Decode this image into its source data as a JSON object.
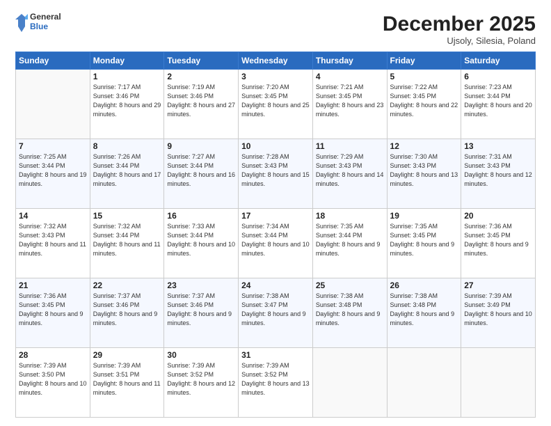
{
  "logo": {
    "general": "General",
    "blue": "Blue"
  },
  "header": {
    "title": "December 2025",
    "subtitle": "Ujsoly, Silesia, Poland"
  },
  "days_of_week": [
    "Sunday",
    "Monday",
    "Tuesday",
    "Wednesday",
    "Thursday",
    "Friday",
    "Saturday"
  ],
  "weeks": [
    [
      {
        "num": "",
        "sunrise": "",
        "sunset": "",
        "daylight": ""
      },
      {
        "num": "1",
        "sunrise": "Sunrise: 7:17 AM",
        "sunset": "Sunset: 3:46 PM",
        "daylight": "Daylight: 8 hours and 29 minutes."
      },
      {
        "num": "2",
        "sunrise": "Sunrise: 7:19 AM",
        "sunset": "Sunset: 3:46 PM",
        "daylight": "Daylight: 8 hours and 27 minutes."
      },
      {
        "num": "3",
        "sunrise": "Sunrise: 7:20 AM",
        "sunset": "Sunset: 3:45 PM",
        "daylight": "Daylight: 8 hours and 25 minutes."
      },
      {
        "num": "4",
        "sunrise": "Sunrise: 7:21 AM",
        "sunset": "Sunset: 3:45 PM",
        "daylight": "Daylight: 8 hours and 23 minutes."
      },
      {
        "num": "5",
        "sunrise": "Sunrise: 7:22 AM",
        "sunset": "Sunset: 3:45 PM",
        "daylight": "Daylight: 8 hours and 22 minutes."
      },
      {
        "num": "6",
        "sunrise": "Sunrise: 7:23 AM",
        "sunset": "Sunset: 3:44 PM",
        "daylight": "Daylight: 8 hours and 20 minutes."
      }
    ],
    [
      {
        "num": "7",
        "sunrise": "Sunrise: 7:25 AM",
        "sunset": "Sunset: 3:44 PM",
        "daylight": "Daylight: 8 hours and 19 minutes."
      },
      {
        "num": "8",
        "sunrise": "Sunrise: 7:26 AM",
        "sunset": "Sunset: 3:44 PM",
        "daylight": "Daylight: 8 hours and 17 minutes."
      },
      {
        "num": "9",
        "sunrise": "Sunrise: 7:27 AM",
        "sunset": "Sunset: 3:44 PM",
        "daylight": "Daylight: 8 hours and 16 minutes."
      },
      {
        "num": "10",
        "sunrise": "Sunrise: 7:28 AM",
        "sunset": "Sunset: 3:43 PM",
        "daylight": "Daylight: 8 hours and 15 minutes."
      },
      {
        "num": "11",
        "sunrise": "Sunrise: 7:29 AM",
        "sunset": "Sunset: 3:43 PM",
        "daylight": "Daylight: 8 hours and 14 minutes."
      },
      {
        "num": "12",
        "sunrise": "Sunrise: 7:30 AM",
        "sunset": "Sunset: 3:43 PM",
        "daylight": "Daylight: 8 hours and 13 minutes."
      },
      {
        "num": "13",
        "sunrise": "Sunrise: 7:31 AM",
        "sunset": "Sunset: 3:43 PM",
        "daylight": "Daylight: 8 hours and 12 minutes."
      }
    ],
    [
      {
        "num": "14",
        "sunrise": "Sunrise: 7:32 AM",
        "sunset": "Sunset: 3:43 PM",
        "daylight": "Daylight: 8 hours and 11 minutes."
      },
      {
        "num": "15",
        "sunrise": "Sunrise: 7:32 AM",
        "sunset": "Sunset: 3:44 PM",
        "daylight": "Daylight: 8 hours and 11 minutes."
      },
      {
        "num": "16",
        "sunrise": "Sunrise: 7:33 AM",
        "sunset": "Sunset: 3:44 PM",
        "daylight": "Daylight: 8 hours and 10 minutes."
      },
      {
        "num": "17",
        "sunrise": "Sunrise: 7:34 AM",
        "sunset": "Sunset: 3:44 PM",
        "daylight": "Daylight: 8 hours and 10 minutes."
      },
      {
        "num": "18",
        "sunrise": "Sunrise: 7:35 AM",
        "sunset": "Sunset: 3:44 PM",
        "daylight": "Daylight: 8 hours and 9 minutes."
      },
      {
        "num": "19",
        "sunrise": "Sunrise: 7:35 AM",
        "sunset": "Sunset: 3:45 PM",
        "daylight": "Daylight: 8 hours and 9 minutes."
      },
      {
        "num": "20",
        "sunrise": "Sunrise: 7:36 AM",
        "sunset": "Sunset: 3:45 PM",
        "daylight": "Daylight: 8 hours and 9 minutes."
      }
    ],
    [
      {
        "num": "21",
        "sunrise": "Sunrise: 7:36 AM",
        "sunset": "Sunset: 3:45 PM",
        "daylight": "Daylight: 8 hours and 9 minutes."
      },
      {
        "num": "22",
        "sunrise": "Sunrise: 7:37 AM",
        "sunset": "Sunset: 3:46 PM",
        "daylight": "Daylight: 8 hours and 9 minutes."
      },
      {
        "num": "23",
        "sunrise": "Sunrise: 7:37 AM",
        "sunset": "Sunset: 3:46 PM",
        "daylight": "Daylight: 8 hours and 9 minutes."
      },
      {
        "num": "24",
        "sunrise": "Sunrise: 7:38 AM",
        "sunset": "Sunset: 3:47 PM",
        "daylight": "Daylight: 8 hours and 9 minutes."
      },
      {
        "num": "25",
        "sunrise": "Sunrise: 7:38 AM",
        "sunset": "Sunset: 3:48 PM",
        "daylight": "Daylight: 8 hours and 9 minutes."
      },
      {
        "num": "26",
        "sunrise": "Sunrise: 7:38 AM",
        "sunset": "Sunset: 3:48 PM",
        "daylight": "Daylight: 8 hours and 9 minutes."
      },
      {
        "num": "27",
        "sunrise": "Sunrise: 7:39 AM",
        "sunset": "Sunset: 3:49 PM",
        "daylight": "Daylight: 8 hours and 10 minutes."
      }
    ],
    [
      {
        "num": "28",
        "sunrise": "Sunrise: 7:39 AM",
        "sunset": "Sunset: 3:50 PM",
        "daylight": "Daylight: 8 hours and 10 minutes."
      },
      {
        "num": "29",
        "sunrise": "Sunrise: 7:39 AM",
        "sunset": "Sunset: 3:51 PM",
        "daylight": "Daylight: 8 hours and 11 minutes."
      },
      {
        "num": "30",
        "sunrise": "Sunrise: 7:39 AM",
        "sunset": "Sunset: 3:52 PM",
        "daylight": "Daylight: 8 hours and 12 minutes."
      },
      {
        "num": "31",
        "sunrise": "Sunrise: 7:39 AM",
        "sunset": "Sunset: 3:52 PM",
        "daylight": "Daylight: 8 hours and 13 minutes."
      },
      {
        "num": "",
        "sunrise": "",
        "sunset": "",
        "daylight": ""
      },
      {
        "num": "",
        "sunrise": "",
        "sunset": "",
        "daylight": ""
      },
      {
        "num": "",
        "sunrise": "",
        "sunset": "",
        "daylight": ""
      }
    ]
  ]
}
